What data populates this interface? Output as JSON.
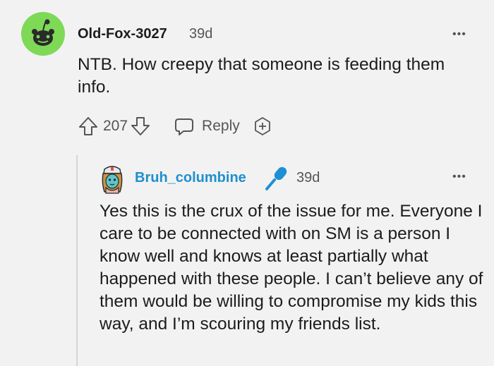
{
  "comment": {
    "author": "Old-Fox-3027",
    "time": "39d",
    "more": "•••",
    "body": "NTB. How creepy that someone is feeding them info.",
    "score": "207",
    "reply_label": "Reply"
  },
  "reply": {
    "author": "Bruh_columbine",
    "time": "39d",
    "more": "•••",
    "body": "Yes this is the crux of the issue for me. Everyone I care to be connected with on SM is a person I know well and knows at least partially what happened with these people. I can’t believe any of them would be willing to compromise my kids this way, and I’m scouring my friends list."
  },
  "colors": {
    "avatar_green": "#7ed957",
    "username_link": "#1f8fcf",
    "mic_blue": "#1d8fd6"
  },
  "icons": {
    "upvote": "arrow-up-outline-icon",
    "downvote": "arrow-down-outline-icon",
    "reply": "speech-bubble-icon",
    "award": "award-plus-icon",
    "flair": "microphone-icon",
    "more": "ellipsis-icon"
  }
}
